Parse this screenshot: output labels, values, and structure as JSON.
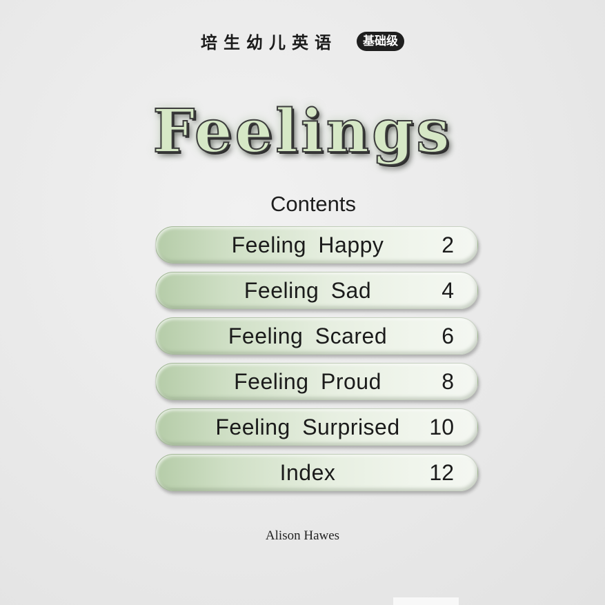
{
  "header": {
    "series_name": "培生幼儿英语",
    "level_badge": "基础级"
  },
  "title": "Feelings",
  "contents": {
    "heading": "Contents",
    "items": [
      {
        "label": "Feeling Happy",
        "page": "2"
      },
      {
        "label": "Feeling Sad",
        "page": "4"
      },
      {
        "label": "Feeling Scared",
        "page": "6"
      },
      {
        "label": "Feeling Proud",
        "page": "8"
      },
      {
        "label": "Feeling Surprised",
        "page": "10"
      },
      {
        "label": "Index",
        "page": "12"
      }
    ]
  },
  "author": "Alison Hawes",
  "colors": {
    "background": "#e9e9e9",
    "pill_green": "#b5cca8",
    "title_fill": "#d6e8c6",
    "text": "#1b1b1b"
  }
}
